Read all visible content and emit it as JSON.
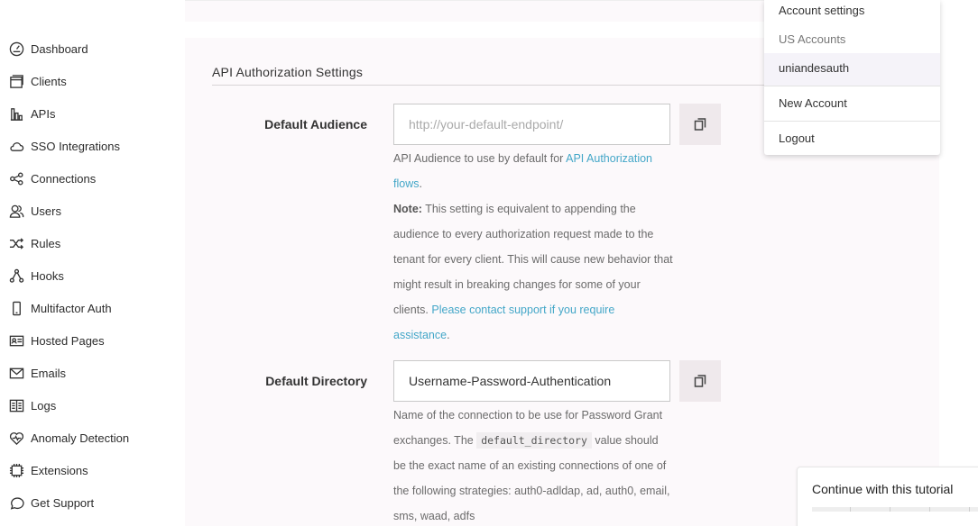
{
  "sidebar": {
    "items": [
      {
        "label": "Dashboard",
        "icon": "dashboard-gauge-icon"
      },
      {
        "label": "Clients",
        "icon": "clients-window-icon"
      },
      {
        "label": "APIs",
        "icon": "apis-bars-icon"
      },
      {
        "label": "SSO Integrations",
        "icon": "cloud-icon"
      },
      {
        "label": "Connections",
        "icon": "connections-nodes-icon"
      },
      {
        "label": "Users",
        "icon": "users-icon"
      },
      {
        "label": "Rules",
        "icon": "shuffle-icon"
      },
      {
        "label": "Hooks",
        "icon": "hooks-nodes-icon"
      },
      {
        "label": "Multifactor Auth",
        "icon": "phone-icon"
      },
      {
        "label": "Hosted Pages",
        "icon": "id-card-icon"
      },
      {
        "label": "Emails",
        "icon": "envelope-icon"
      },
      {
        "label": "Logs",
        "icon": "book-icon"
      },
      {
        "label": "Anomaly Detection",
        "icon": "heart-pulse-icon"
      },
      {
        "label": "Extensions",
        "icon": "chip-icon"
      },
      {
        "label": "Get Support",
        "icon": "chat-bubble-icon"
      }
    ]
  },
  "main": {
    "section_title": "API Authorization Settings",
    "default_audience": {
      "label": "Default Audience",
      "value": "",
      "placeholder": "http://your-default-endpoint/",
      "help_prefix": "API Audience to use by default for ",
      "help_link": "API Authorization flows",
      "help_suffix": ".",
      "note_label": "Note:",
      "note_text": " This setting is equivalent to appending the audience to every authorization request made to the tenant for every client. This will cause new behavior that might result in breaking changes for some of your clients. ",
      "note_link": "Please contact support if you require assistance",
      "note_suffix": "."
    },
    "default_directory": {
      "label": "Default Directory",
      "value": "Username-Password-Authentication",
      "help_prefix": "Name of the connection to be use for Password Grant exchanges. The ",
      "help_code": "default_directory",
      "help_suffix": " value should be the exact name of an existing connections of one of the following strategies: auth0-adldap, ad, auth0, email, sms, waad, adfs"
    },
    "copy_icon": "copy-icon"
  },
  "dropdown": {
    "account_settings": "Account settings",
    "region": "US Accounts",
    "tenant": "uniandesauth",
    "new_account": "New Account",
    "logout": "Logout"
  },
  "tutorial": {
    "label": "Continue with this tutorial",
    "progress": 0
  },
  "colors": {
    "link": "#44a7c8",
    "card_bg": "#fcf9fb",
    "copy_btn_bg": "#efe9ec"
  }
}
